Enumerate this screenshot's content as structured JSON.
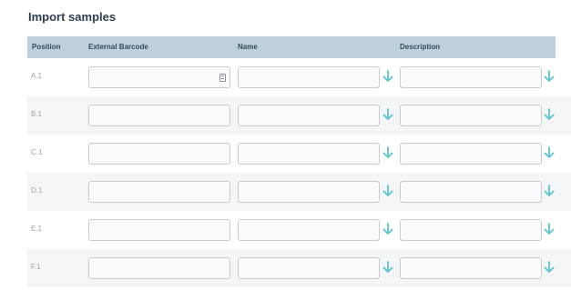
{
  "page": {
    "title": "Import samples"
  },
  "table": {
    "columns": [
      "Position",
      "External Barcode",
      "Name",
      "Description"
    ],
    "rows": [
      {
        "position": "A.1",
        "barcode": "",
        "name": "",
        "description": ""
      },
      {
        "position": "B.1",
        "barcode": "",
        "name": "",
        "description": ""
      },
      {
        "position": "C.1",
        "barcode": "",
        "name": "",
        "description": ""
      },
      {
        "position": "D.1",
        "barcode": "",
        "name": "",
        "description": ""
      },
      {
        "position": "E.1",
        "barcode": "",
        "name": "",
        "description": ""
      },
      {
        "position": "F.1",
        "barcode": "",
        "name": "",
        "description": ""
      }
    ]
  },
  "icons": {
    "barcode": "barcode-scan-icon",
    "fill_down": "arrow-down-icon"
  },
  "colors": {
    "header_bg": "#bdd0dc",
    "arrow": "#5bc4cc",
    "title": "#2d3e50"
  }
}
